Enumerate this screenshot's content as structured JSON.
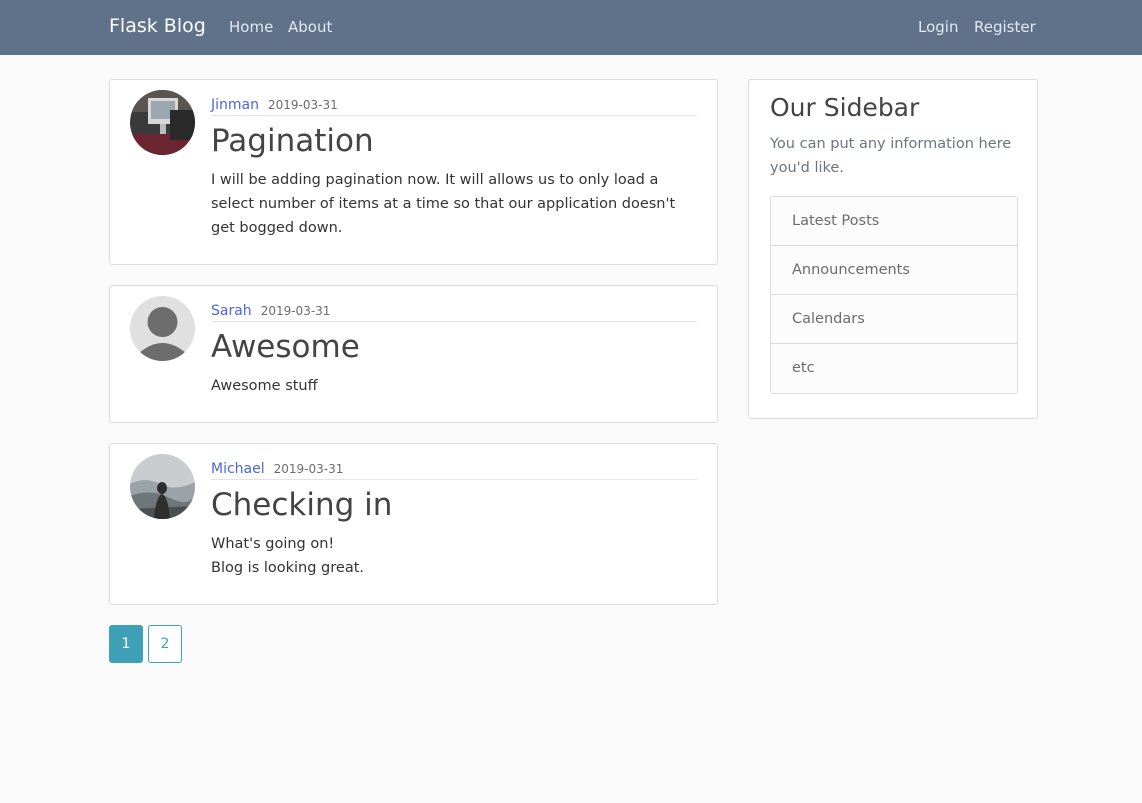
{
  "navbar": {
    "brand": "Flask Blog",
    "left_links": [
      "Home",
      "About"
    ],
    "right_links": [
      "Login",
      "Register"
    ]
  },
  "posts": [
    {
      "author": "Jinman",
      "date": "2019-03-31",
      "title": "Pagination",
      "content": [
        "I will be adding pagination now. It will allows us to only load a select number of items at a time so that our application doesn't get bogged down."
      ],
      "avatar_icon": "photo-avatar-icon"
    },
    {
      "author": "Sarah",
      "date": "2019-03-31",
      "title": "Awesome",
      "content": [
        "Awesome stuff"
      ],
      "avatar_icon": "default-user-avatar-icon"
    },
    {
      "author": "Michael",
      "date": "2019-03-31",
      "title": "Checking in",
      "content": [
        "What's going on!",
        "Blog is looking great."
      ],
      "avatar_icon": "landscape-avatar-icon"
    }
  ],
  "pagination": {
    "pages": [
      "1",
      "2"
    ],
    "current": "1"
  },
  "sidebar": {
    "title": "Our Sidebar",
    "text": "You can put any information here you'd like.",
    "items": [
      "Latest Posts",
      "Announcements",
      "Calendars",
      "etc"
    ]
  },
  "colors": {
    "navbar": "#5f728a",
    "accent": "#3fa1b7",
    "author_link": "#4a67d6"
  }
}
